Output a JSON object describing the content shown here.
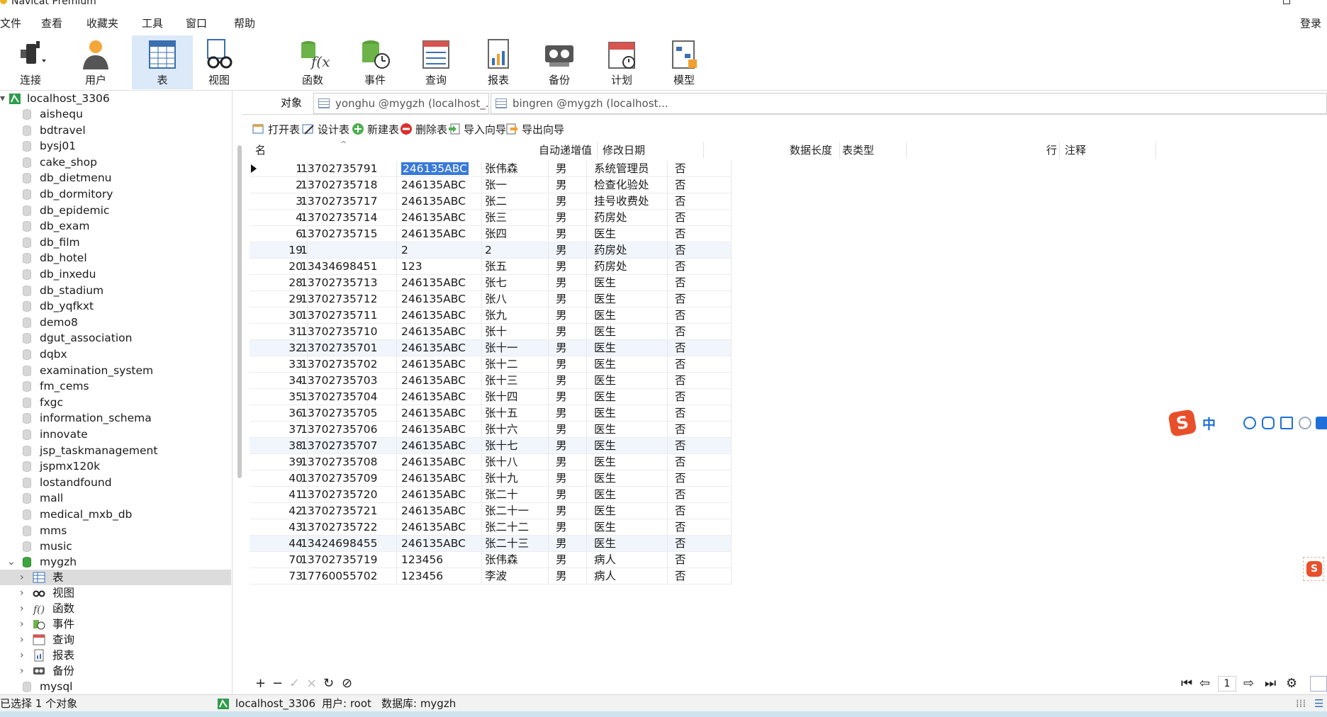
{
  "app": {
    "title": "Navicat Premium",
    "login": "登录"
  },
  "menu": [
    "文件",
    "查看",
    "收藏夹",
    "工具",
    "窗口",
    "帮助"
  ],
  "toolbar": [
    "连接",
    "用户",
    "表",
    "视图",
    "函数",
    "事件",
    "查询",
    "报表",
    "备份",
    "计划",
    "模型"
  ],
  "sidebar": {
    "connection": "localhost_3306",
    "databases": [
      "aishequ",
      "bdtravel",
      "bysj01",
      "cake_shop",
      "db_dietmenu",
      "db_dormitory",
      "db_epidemic",
      "db_exam",
      "db_film",
      "db_hotel",
      "db_inxedu",
      "db_stadium",
      "db_yqfkxt",
      "demo8",
      "dgut_association",
      "dqbx",
      "examination_system",
      "fm_cems",
      "fxgc",
      "information_schema",
      "innovate",
      "jsp_taskmanagement",
      "jspmx120k",
      "lostandfound",
      "mall",
      "medical_mxb_db",
      "mms",
      "music"
    ],
    "open_db": "mygzh",
    "sub_items": [
      "表",
      "视图",
      "函数",
      "事件",
      "查询",
      "报表",
      "备份"
    ],
    "after_db": "mysql"
  },
  "tabs": {
    "objects": "对象",
    "file1": "yonghu @mygzh (localhost_...",
    "file2": "bingren @mygzh (localhost..."
  },
  "actions": [
    "打开表",
    "设计表",
    "新建表",
    "删除表",
    "导入向导",
    "导出向导"
  ],
  "columns": {
    "name": "名",
    "auto": "自动递增值",
    "modified": "修改日期",
    "datalen": "数据长度",
    "tabletype": "表类型",
    "rows": "行",
    "comment": "注释"
  },
  "rows": [
    [
      "1",
      "13702735791",
      "246135ABC",
      "张伟森",
      "男",
      "系统管理员",
      "否"
    ],
    [
      "2",
      "13702735718",
      "246135ABC",
      "张一",
      "男",
      "检查化验处",
      "否"
    ],
    [
      "3",
      "13702735717",
      "246135ABC",
      "张二",
      "男",
      "挂号收费处",
      "否"
    ],
    [
      "4",
      "13702735714",
      "246135ABC",
      "张三",
      "男",
      "药房处",
      "否"
    ],
    [
      "6",
      "13702735715",
      "246135ABC",
      "张四",
      "男",
      "医生",
      "否"
    ],
    [
      "19",
      "1",
      "2",
      "2",
      "男",
      "药房处",
      "否"
    ],
    [
      "20",
      "13434698451",
      "123",
      "张五",
      "男",
      "药房处",
      "否"
    ],
    [
      "28",
      "13702735713",
      "246135ABC",
      "张七",
      "男",
      "医生",
      "否"
    ],
    [
      "29",
      "13702735712",
      "246135ABC",
      "张八",
      "男",
      "医生",
      "否"
    ],
    [
      "30",
      "13702735711",
      "246135ABC",
      "张九",
      "男",
      "医生",
      "否"
    ],
    [
      "31",
      "13702735710",
      "246135ABC",
      "张十",
      "男",
      "医生",
      "否"
    ],
    [
      "32",
      "13702735701",
      "246135ABC",
      "张十一",
      "男",
      "医生",
      "否"
    ],
    [
      "33",
      "13702735702",
      "246135ABC",
      "张十二",
      "男",
      "医生",
      "否"
    ],
    [
      "34",
      "13702735703",
      "246135ABC",
      "张十三",
      "男",
      "医生",
      "否"
    ],
    [
      "35",
      "13702735704",
      "246135ABC",
      "张十四",
      "男",
      "医生",
      "否"
    ],
    [
      "36",
      "13702735705",
      "246135ABC",
      "张十五",
      "男",
      "医生",
      "否"
    ],
    [
      "37",
      "13702735706",
      "246135ABC",
      "张十六",
      "男",
      "医生",
      "否"
    ],
    [
      "38",
      "13702735707",
      "246135ABC",
      "张十七",
      "男",
      "医生",
      "否"
    ],
    [
      "39",
      "13702735708",
      "246135ABC",
      "张十八",
      "男",
      "医生",
      "否"
    ],
    [
      "40",
      "13702735709",
      "246135ABC",
      "张十九",
      "男",
      "医生",
      "否"
    ],
    [
      "41",
      "13702735720",
      "246135ABC",
      "张二十",
      "男",
      "医生",
      "否"
    ],
    [
      "42",
      "13702735721",
      "246135ABC",
      "张二十一",
      "男",
      "医生",
      "否"
    ],
    [
      "43",
      "13702735722",
      "246135ABC",
      "张二十二",
      "男",
      "医生",
      "否"
    ],
    [
      "44",
      "13424698455",
      "246135ABC",
      "张二十三",
      "男",
      "医生",
      "否"
    ],
    [
      "70",
      "13702735719",
      "123456",
      "张伟森",
      "男",
      "病人",
      "否"
    ],
    [
      "73",
      "17760055702",
      "123456",
      "李波",
      "男",
      "病人",
      "否"
    ]
  ],
  "selected_cell": {
    "row": 0,
    "col": 2
  },
  "pager": {
    "page": "1"
  },
  "ime": {
    "label": "中"
  },
  "status": {
    "selection": "已选择 1 个对象",
    "connection": "localhost_3306",
    "user": "用户: root",
    "database": "数据库: mygzh"
  },
  "colors": {
    "selection": "#3879d9",
    "active_toolbar": "#dbe9f8",
    "db_open": "#3ea53e"
  }
}
